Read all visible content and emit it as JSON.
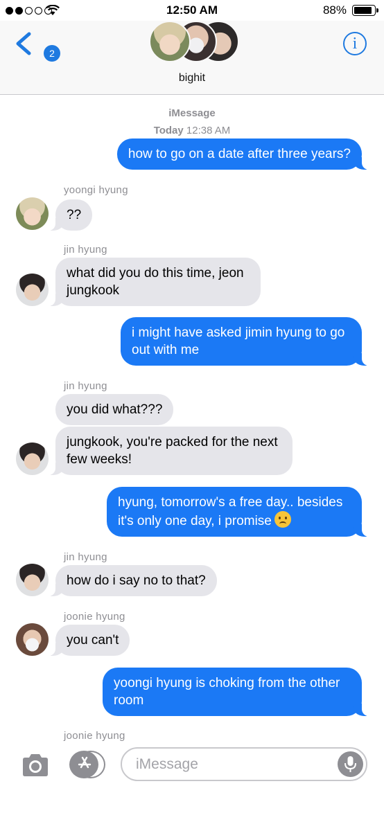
{
  "status_bar": {
    "time": "12:50 AM",
    "battery_percent": "88%",
    "signal_bars_filled": 2,
    "signal_bars_total": 5
  },
  "header": {
    "back_badge_count": "2",
    "chat_title": "bighit",
    "info_label": "i"
  },
  "thread": {
    "service_label": "iMessage",
    "day_label": "Today",
    "day_time": "12:38 AM"
  },
  "messages": [
    {
      "direction": "outgoing",
      "text": "how to go on a date after three years?"
    },
    {
      "direction": "incoming",
      "sender": "yoongi hyung",
      "text": "??"
    },
    {
      "direction": "incoming",
      "sender": "jin hyung",
      "text": "what did you do this time, jeon jungkook"
    },
    {
      "direction": "outgoing",
      "text": "i might have asked jimin hyung to go out with me"
    },
    {
      "direction": "incoming",
      "sender": "jin hyung",
      "text": "you did what???"
    },
    {
      "direction": "incoming",
      "text": "jungkook, you're packed for the next few weeks!"
    },
    {
      "direction": "outgoing",
      "text": "hyung, tomorrow's a free day.. besides it's only one day, i promise",
      "emoji": "slightly-frowning-face"
    },
    {
      "direction": "incoming",
      "sender": "jin hyung",
      "text": "how do i say no to that?"
    },
    {
      "direction": "incoming",
      "sender": "joonie hyung",
      "text": "you can't"
    },
    {
      "direction": "outgoing",
      "text": "yoongi hyung is choking from the other room"
    },
    {
      "direction": "incoming",
      "sender": "joonie hyung",
      "text": ""
    }
  ],
  "input_bar": {
    "placeholder": "iMessage",
    "value": ""
  },
  "icons": {
    "back": "chevron-left-icon",
    "info": "info-circle-icon",
    "camera": "camera-icon",
    "apps": "app-store-icon",
    "mic": "microphone-icon",
    "wifi": "wifi-icon",
    "battery": "battery-icon"
  },
  "colors": {
    "accent_blue": "#1f7ae0",
    "outgoing_bubble": "#1b79f5",
    "incoming_bubble": "#e5e5ea",
    "meta_gray": "#8e8e93"
  }
}
